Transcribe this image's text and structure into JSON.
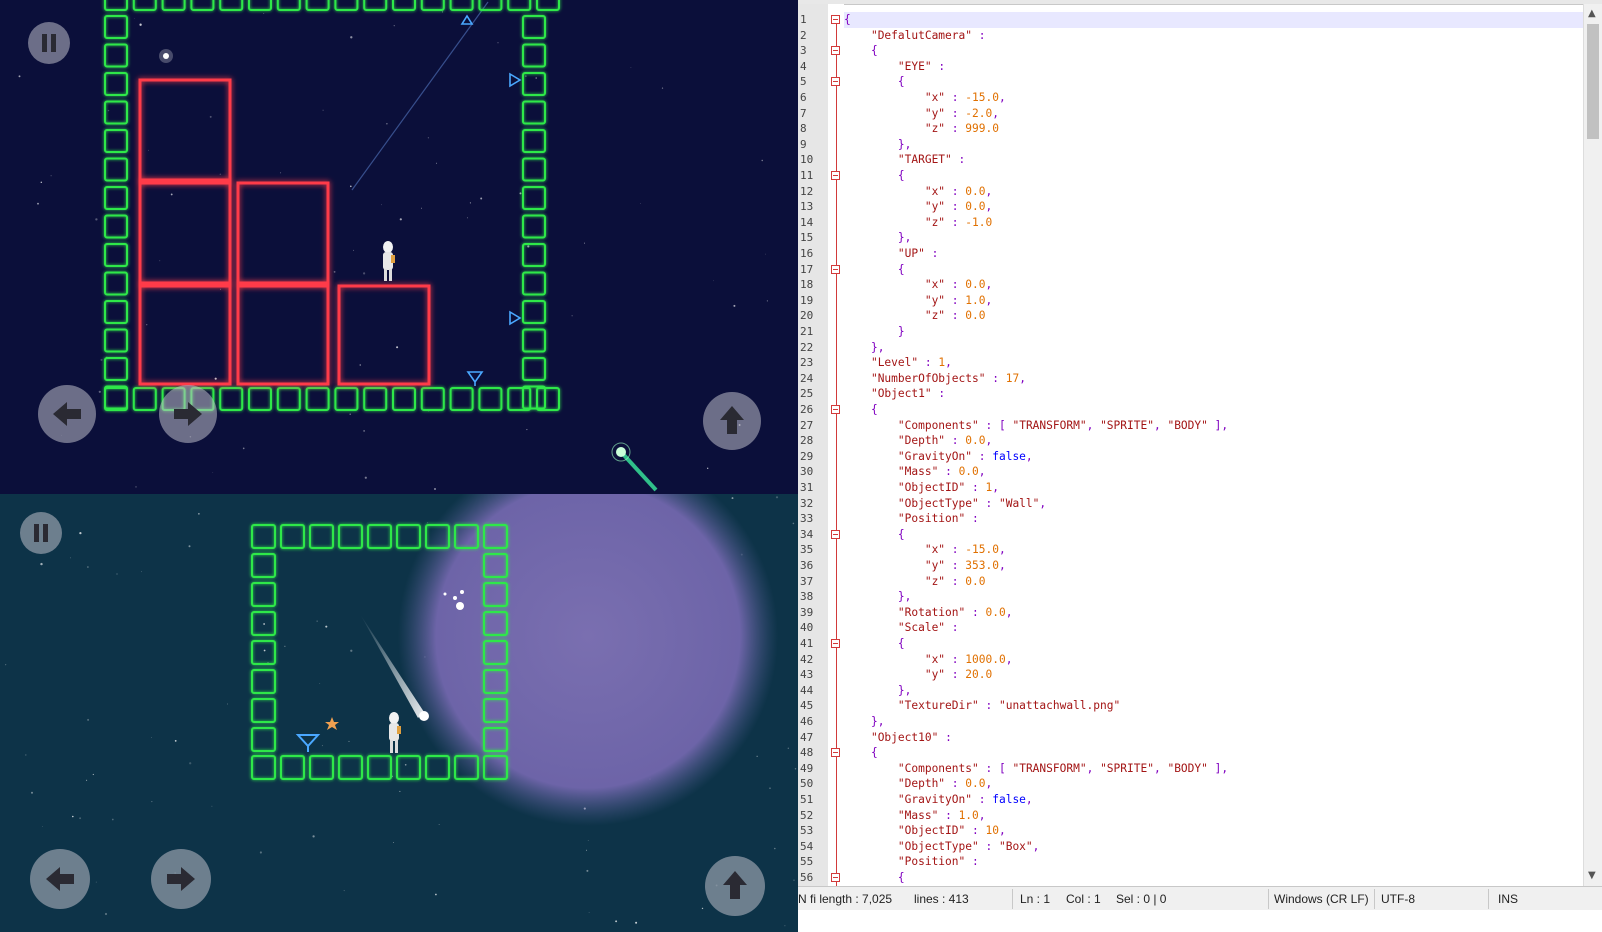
{
  "editor": {
    "lines": [
      "{",
      "    \"DefalutCamera\" :",
      "    {",
      "        \"EYE\" :",
      "        {",
      "            \"x\" : -15.0,",
      "            \"y\" : -2.0,",
      "            \"z\" : 999.0",
      "        },",
      "        \"TARGET\" :",
      "        {",
      "            \"x\" : 0.0,",
      "            \"y\" : 0.0,",
      "            \"z\" : -1.0",
      "        },",
      "        \"UP\" :",
      "        {",
      "            \"x\" : 0.0,",
      "            \"y\" : 1.0,",
      "            \"z\" : 0.0",
      "        }",
      "    },",
      "    \"Level\" : 1,",
      "    \"NumberOfObjects\" : 17,",
      "    \"Object1\" :",
      "    {",
      "        \"Components\" : [ \"TRANSFORM\", \"SPRITE\", \"BODY\" ],",
      "        \"Depth\" : 0.0,",
      "        \"GravityOn\" : false,",
      "        \"Mass\" : 0.0,",
      "        \"ObjectID\" : 1,",
      "        \"ObjectType\" : \"Wall\",",
      "        \"Position\" :",
      "        {",
      "            \"x\" : -15.0,",
      "            \"y\" : 353.0,",
      "            \"z\" : 0.0",
      "        },",
      "        \"Rotation\" : 0.0,",
      "        \"Scale\" :",
      "        {",
      "            \"x\" : 1000.0,",
      "            \"y\" : 20.0",
      "        },",
      "        \"TextureDir\" : \"unattachwall.png\"",
      "    },",
      "    \"Object10\" :",
      "    {",
      "        \"Components\" : [ \"TRANSFORM\", \"SPRITE\", \"BODY\" ],",
      "        \"Depth\" : 0.0,",
      "        \"GravityOn\" : false,",
      "        \"Mass\" : 1.0,",
      "        \"ObjectID\" : 10,",
      "        \"ObjectType\" : \"Box\",",
      "        \"Position\" :",
      "        {"
    ],
    "line_numbers": [
      "1",
      "2",
      "3",
      "4",
      "5",
      "6",
      "7",
      "8",
      "9",
      "10",
      "11",
      "12",
      "13",
      "14",
      "15",
      "16",
      "17",
      "18",
      "19",
      "20",
      "21",
      "22",
      "23",
      "24",
      "25",
      "26",
      "27",
      "28",
      "29",
      "30",
      "31",
      "32",
      "33",
      "34",
      "35",
      "36",
      "37",
      "38",
      "39",
      "40",
      "41",
      "42",
      "43",
      "44",
      "45",
      "46",
      "47",
      "48",
      "49",
      "50",
      "51",
      "52",
      "53",
      "54",
      "55",
      "56"
    ],
    "fold_lines": [
      1,
      3,
      5,
      11,
      17,
      26,
      34,
      41,
      48,
      56
    ]
  },
  "status": {
    "length": "N fi length : 7,025",
    "lines": "lines : 413",
    "ln": "Ln : 1",
    "col": "Col : 1",
    "sel": "Sel : 0 | 0",
    "eol": "Windows (CR LF)",
    "encoding": "UTF-8",
    "mode": "INS"
  },
  "game": {
    "buttons": [
      "pause",
      "left",
      "right",
      "jump"
    ],
    "colors": {
      "wall": "#2ee84a",
      "box": "#ff3b4a",
      "sky_top": "#0b0f3a",
      "sky_bottom": "#0d3348"
    }
  }
}
